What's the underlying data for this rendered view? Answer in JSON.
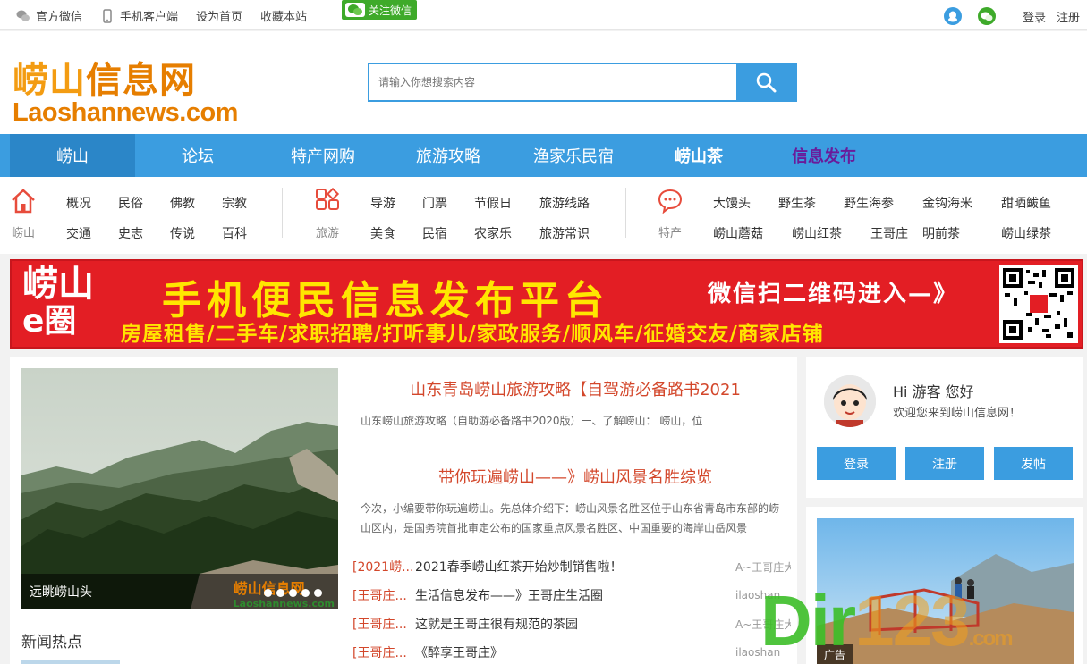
{
  "topbar": {
    "links": [
      "官方微信",
      "手机客户端",
      "设为首页",
      "收藏本站"
    ],
    "wechat_follow": "关注微信",
    "login": "登录",
    "register": "注册"
  },
  "logo": {
    "cn_a": "崂山",
    "cn_b": "信息网",
    "en_a": "Laoshan",
    "en_b": "news",
    "en_c": ".com"
  },
  "search": {
    "placeholder": "请输入你想搜索内容"
  },
  "nav": [
    "崂山",
    "论坛",
    "特产网购",
    "旅游攻略",
    "渔家乐民宿",
    "崂山茶",
    "信息发布"
  ],
  "cats": {
    "laoshan": {
      "label": "崂山",
      "row1": [
        "概况",
        "民俗",
        "佛教",
        "宗教"
      ],
      "row2": [
        "交通",
        "史志",
        "传说",
        "百科"
      ]
    },
    "travel": {
      "label": "旅游",
      "row1": [
        "导游",
        "门票",
        "节假日",
        "旅游线路"
      ],
      "row2": [
        "美食",
        "民宿",
        "农家乐",
        "旅游常识"
      ]
    },
    "special": {
      "label": "特产",
      "row1": [
        "大馒头",
        "野生茶",
        "野生海参",
        "金钩海米",
        "甜晒鲅鱼"
      ],
      "row2": [
        "崂山蘑菇",
        "崂山红茶",
        "王哥庄",
        "明前茶",
        "崂山绿茶"
      ]
    }
  },
  "banner": {
    "logo_text": "崂山",
    "logo_e": "e圈",
    "title": "手机便民信息发布平台",
    "subtitle": "房屋租售/二手车/求职招聘/打听事儿/家政服务/顺风车/征婚交友/商家店铺",
    "right": "微信扫二维码进入—》"
  },
  "slider": {
    "caption": "远眺崂山头",
    "watermark_cn": "崂山信息网",
    "watermark_en": "Laoshannews.com"
  },
  "articles": [
    {
      "title": "山东青岛崂山旅游攻略【自驾游必备路书2021",
      "desc": "山东崂山旅游攻略（自助游必备路书2020版）一、了解崂山： 崂山，位"
    },
    {
      "title": "带你玩遍崂山——》崂山风景名胜综览",
      "desc": "今次，小编要带你玩遍崂山。先总体介绍下：崂山风景名胜区位于山东省青岛市东部的崂山区内，是国务院首批审定公布的国家重点风景名胜区、中国重要的海岸山岳风景"
    }
  ],
  "news": [
    {
      "tag": "[2021崂...",
      "title": "2021春季崂山红茶开始炒制销售啦！",
      "author": "A~王哥庄大"
    },
    {
      "tag": "[王哥庄...",
      "title": "生活信息发布——》王哥庄生活圈",
      "author": "ilaoshan"
    },
    {
      "tag": "[王哥庄...",
      "title": "这就是王哥庄很有规范的茶园",
      "author": "A~王哥庄大"
    },
    {
      "tag": "[王哥庄...",
      "title": "《醉享王哥庄》",
      "author": "ilaoshan"
    }
  ],
  "hot_label": "新闻热点",
  "user": {
    "hi": "Hi 游客 您好",
    "welcome": "欢迎您来到崂山信息网！",
    "login": "登录",
    "register": "注册",
    "post": "发帖"
  },
  "ad": {
    "label": "广告"
  },
  "watermark": {
    "a": "Dir",
    "b": "123",
    "c": ".com"
  }
}
